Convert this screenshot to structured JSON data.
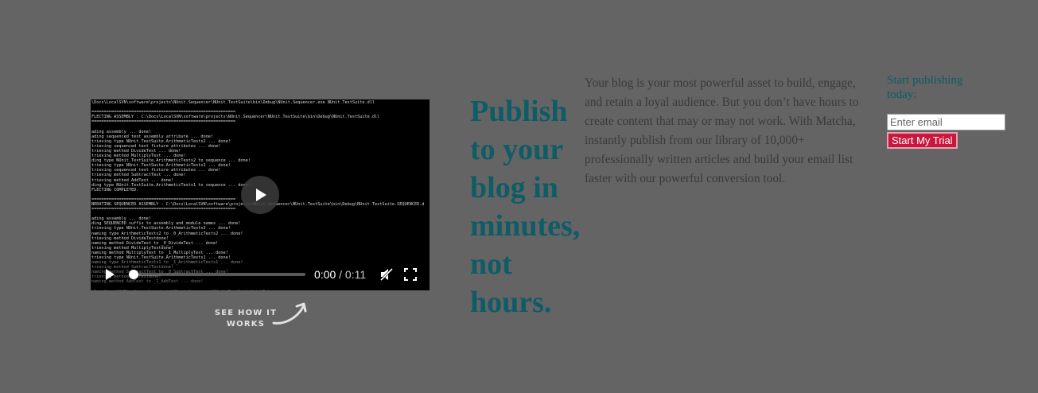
{
  "video": {
    "terminal_lines": [
      "\\Docs\\LocalSVN\\software\\projects\\NUnit.Sequencer\\NUnit.TestSuite\\bin\\Debug\\NUnit.Sequencer.exe NUnit.TestSuite.dll",
      "",
      "==========================================================",
      "FLECTING ASSEMBLY : C:\\Docs\\LocalSVN\\software\\projects\\NUnit.Sequencer\\NUnit.TestSuite\\bin\\Debug\\NUnit.TestSuite.dll",
      "==========================================================",
      "",
      "ading assembly ... done!",
      "ading sequenced test assembly attribute ... done!",
      "trieving type NUnit.TestSuite.ArithmeticTests2 ... done!",
      "trieving sequenced test fixture attributes ... done!",
      "trieving method DivideTest ... done!",
      "trieving method MultiplyTest ... done!",
      "ding type NUnit.TestSuite.ArithmeticTests2 to sequence ... done!",
      "trieving type NUnit.TestSuite.ArithmeticTests1 ... done!",
      "trieving sequenced test fixture attributes ... done!",
      "trieving method SubtractTest ... done!",
      "trieving method AddTest ... done!",
      "ding type NUnit.TestSuite.ArithmeticTests1 to sequence ... done!",
      "FLECTING COMPLETED.",
      "",
      "==========================================================",
      "NERATING SEQUENCED ASSEMBLY : C:\\Docs\\LocalSVN\\software\\projects\\NUnit.Sequencer\\NUnit.TestSuite\\bin\\Debug\\NUnit.TestSuite.SEQUENCED.d",
      "==========================================================",
      "",
      "ading assembly ... done!",
      "ding SEQUENCED suffix to assembly and module names ... done!",
      "trieving type NUnit.TestSuite.ArithmeticTests2 ... done!",
      "naming type ArithmeticTests2 to _0_ArithmeticTests2 ... done!",
      "trieving method DivideTestdone!",
      "naming method DivideTest to _0_DivideTest ... done!",
      "trieving method MultiplyTestdone!",
      "naming method MultiplyTest to _1_MultiplyTest ... done!",
      "trieving type NUnit.TestSuite.ArithmeticTests1 ... done!",
      "naming type ArithmeticTests1 to _1_ArithmeticTests1 ... done!",
      "trieving method SubtractTestdone!",
      "naming method SubtractTest to _0_SubtractTest ... done!",
      "trieving method AddTestdone!",
      "naming method AddTest to _1_AddTest ... done!",
      "",
      "\\Docs\\LocalSVN\\software\\projects\\NUnit.Sequencer\\NUnit.TestSuite\\bin\\Debug>"
    ],
    "current_time": "0:00",
    "separator": "/",
    "duration": "0:11",
    "progress": 0,
    "icons": {
      "big_play": "play-icon",
      "play": "play-icon",
      "mute": "muted-speaker-icon",
      "fullscreen": "fullscreen-icon"
    }
  },
  "cta": {
    "see_how": "SEE HOW IT WORKS",
    "arrow_icon": "curved-arrow-icon"
  },
  "hero": {
    "headline": "Publish to your blog in minutes, not hours.",
    "body": "Your blog is your most powerful asset to build, engage, and retain a loyal audience. But you don’t have hours to create content that may or may not work. With Matcha, instantly publish from our library of 10,000+ professionally written articles and build your email list faster with our powerful conversion tool."
  },
  "signup": {
    "title": "Start publishing today:",
    "email_placeholder": "Enter email",
    "email_value": "",
    "button_label": "Start My Trial"
  },
  "colors": {
    "background": "#646464",
    "headline": "#0d5c66",
    "button": "#c9173d"
  }
}
